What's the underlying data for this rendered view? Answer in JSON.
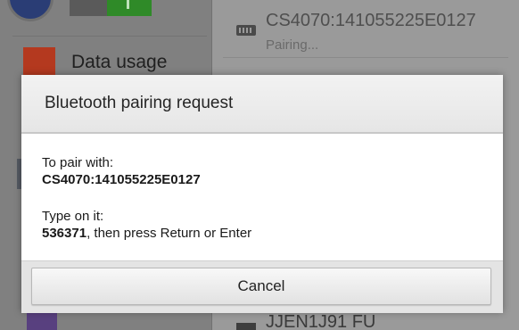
{
  "background": {
    "settings_item_label": "Data usage",
    "device": {
      "name": "CS4070:141055225E0127",
      "status": "Pairing..."
    },
    "bottom_device_name_partial": "JJEN1J91 FU"
  },
  "dialog": {
    "title": "Bluetooth pairing request",
    "pair_with_label": "To pair with:",
    "device_name": "CS4070:141055225E0127",
    "instruction_label": "Type on it:",
    "passkey": "536371",
    "passkey_suffix": ", then press Return or Enter",
    "cancel_label": "Cancel"
  },
  "colors": {
    "dialog_body": "#ffffff",
    "dialog_header": "#eeeeee",
    "dim_overlay": "#8e8e8e",
    "toggle_on": "#2f8a28"
  },
  "icons": {
    "data_usage": "data-usage-icon",
    "keyboard": "keyboard-icon"
  }
}
